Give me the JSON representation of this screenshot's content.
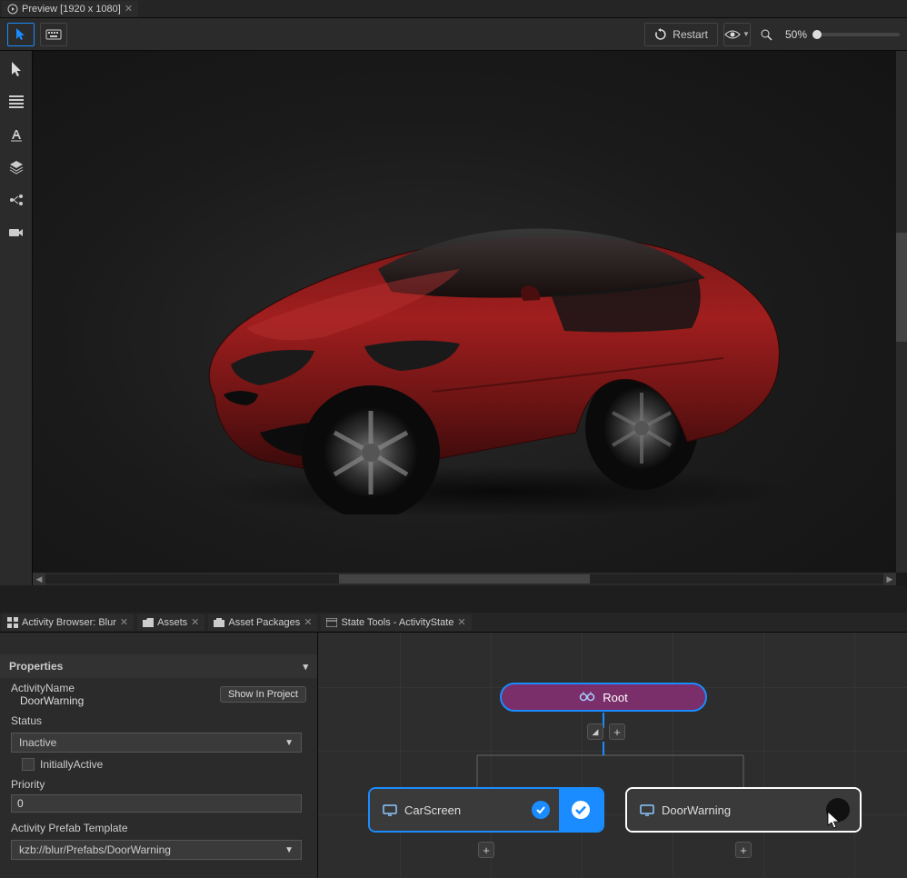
{
  "tabStrip": {
    "previewTab": "Preview  [1920 x 1080]"
  },
  "toolbar": {
    "restart": "Restart",
    "zoom": "50%"
  },
  "lowerTabs": {
    "activityBrowser": "Activity Browser: Blur",
    "assets": "Assets",
    "assetPackages": "Asset Packages",
    "stateTools": "State Tools - ActivityState"
  },
  "properties": {
    "header": "Properties",
    "activityNameLabel": "ActivityName",
    "activityNameValue": "DoorWarning",
    "showInProject": "Show In Project",
    "statusLabel": "Status",
    "statusValue": "Inactive",
    "initiallyActive": "InitiallyActive",
    "priorityLabel": "Priority",
    "priorityValue": "0",
    "prefabTemplateLabel": "Activity Prefab Template",
    "prefabTemplateValue": "kzb://blur/Prefabs/DoorWarning"
  },
  "graph": {
    "rootLabel": "Root",
    "carScreenLabel": "CarScreen",
    "doorWarningLabel": "DoorWarning"
  }
}
